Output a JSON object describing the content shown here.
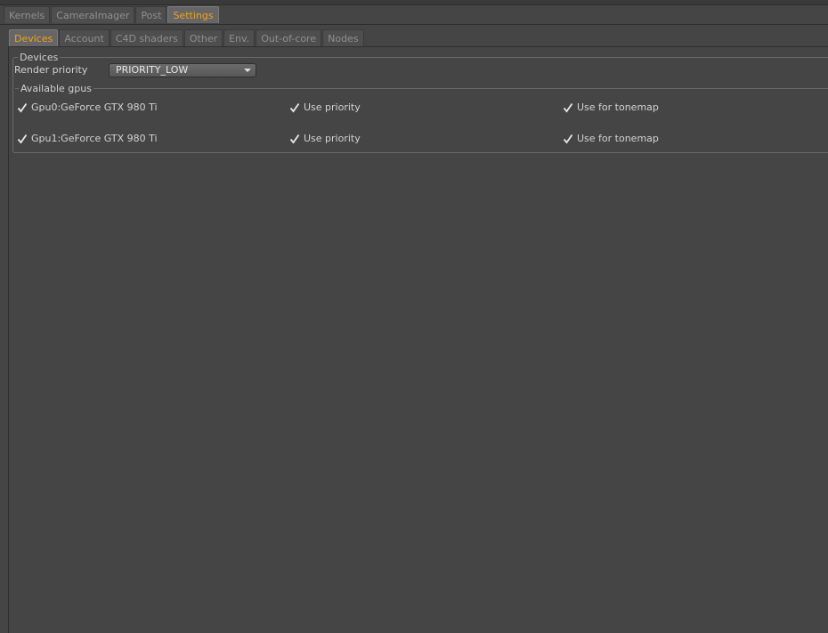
{
  "main_tabs": [
    {
      "label": "Kernels",
      "active": false
    },
    {
      "label": "CameraImager",
      "active": false
    },
    {
      "label": "Post",
      "active": false
    },
    {
      "label": "Settings",
      "active": true
    }
  ],
  "sub_tabs": [
    {
      "label": "Devices",
      "active": true
    },
    {
      "label": "Account",
      "active": false
    },
    {
      "label": "C4D shaders",
      "active": false
    },
    {
      "label": "Other",
      "active": false
    },
    {
      "label": "Env.",
      "active": false
    },
    {
      "label": "Out-of-core",
      "active": false
    },
    {
      "label": "Nodes",
      "active": false
    }
  ],
  "devices": {
    "group_title": "Devices",
    "render_priority_label": "Render priority",
    "render_priority_value": "PRIORITY_LOW",
    "gpus_group_title": "Available gpus",
    "gpus": [
      {
        "name": "Gpu0:GeForce GTX 980 Ti",
        "enabled": true,
        "use_priority_label": "Use priority",
        "use_priority": true,
        "use_for_tonemap_label": "Use for tonemap",
        "use_for_tonemap": true
      },
      {
        "name": "Gpu1:GeForce GTX 980 Ti",
        "enabled": true,
        "use_priority_label": "Use priority",
        "use_priority": true,
        "use_for_tonemap_label": "Use for tonemap",
        "use_for_tonemap": true
      }
    ]
  },
  "colors": {
    "background": "#454545",
    "active_tab_text": "#f0a020",
    "text": "#cfcfcf"
  }
}
